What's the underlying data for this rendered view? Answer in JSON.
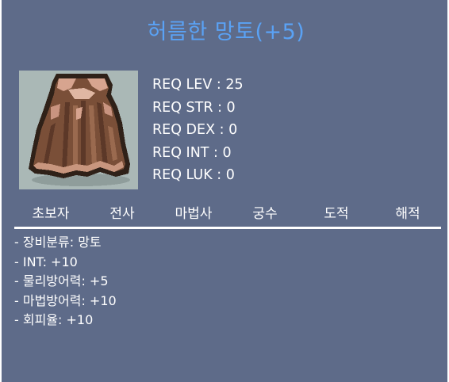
{
  "item": {
    "title": "허름한 망토(+5)",
    "icon": "cape-icon"
  },
  "requirements": [
    "REQ LEV : 25",
    "REQ STR : 0",
    "REQ DEX : 0",
    "REQ INT : 0",
    "REQ LUK : 0"
  ],
  "jobs": [
    "초보자",
    "전사",
    "마법사",
    "궁수",
    "도적",
    "해적"
  ],
  "stats": [
    "- 장비분류: 망토",
    "- INT: +10",
    "- 물리방어력: +5",
    "- 마법방어력: +10",
    "- 회피율: +10"
  ],
  "colors": {
    "background": "#5e6b89",
    "title": "#5aa2f5",
    "text": "#ffffff",
    "icon_background": "#aab8b6"
  }
}
